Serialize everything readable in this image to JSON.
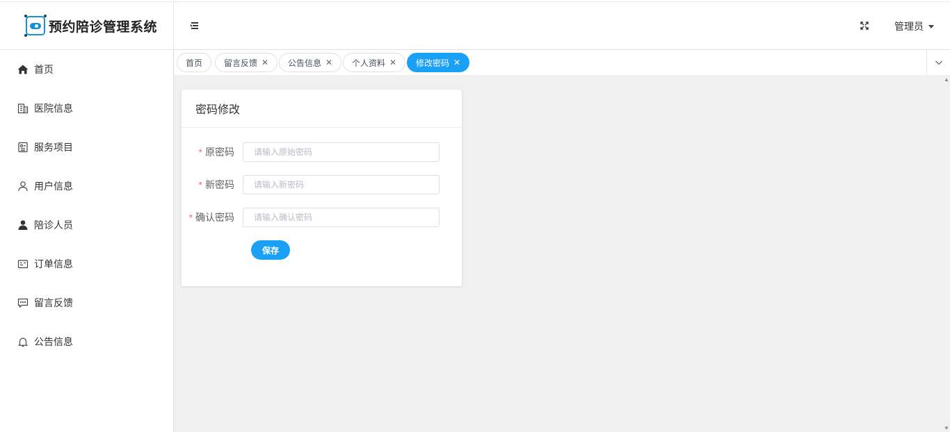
{
  "app": {
    "title": "预约陪诊管理系统"
  },
  "sidebar": {
    "items": [
      {
        "label": "首页",
        "icon": "home-icon"
      },
      {
        "label": "医院信息",
        "icon": "building-icon"
      },
      {
        "label": "服务项目",
        "icon": "service-icon"
      },
      {
        "label": "用户信息",
        "icon": "user-icon"
      },
      {
        "label": "陪诊人员",
        "icon": "person-filled-icon"
      },
      {
        "label": "订单信息",
        "icon": "order-icon"
      },
      {
        "label": "留言反馈",
        "icon": "message-icon"
      },
      {
        "label": "公告信息",
        "icon": "bell-icon"
      }
    ]
  },
  "header": {
    "user_label": "管理员"
  },
  "tags": [
    {
      "label": "首页",
      "closable": false,
      "active": false
    },
    {
      "label": "留言反馈",
      "closable": true,
      "active": false
    },
    {
      "label": "公告信息",
      "closable": true,
      "active": false
    },
    {
      "label": "个人资料",
      "closable": true,
      "active": false
    },
    {
      "label": "修改密码",
      "closable": true,
      "active": true
    }
  ],
  "form": {
    "title": "密码修改",
    "fields": [
      {
        "label": "原密码",
        "placeholder": "请输入原始密码",
        "required": true
      },
      {
        "label": "新密码",
        "placeholder": "请输入新密码",
        "required": true
      },
      {
        "label": "确认密码",
        "placeholder": "请输入确认密码",
        "required": true
      }
    ],
    "save_label": "保存"
  },
  "colors": {
    "accent": "#1aa1f5",
    "brand": "#1890d7",
    "required": "#f56c6c"
  }
}
